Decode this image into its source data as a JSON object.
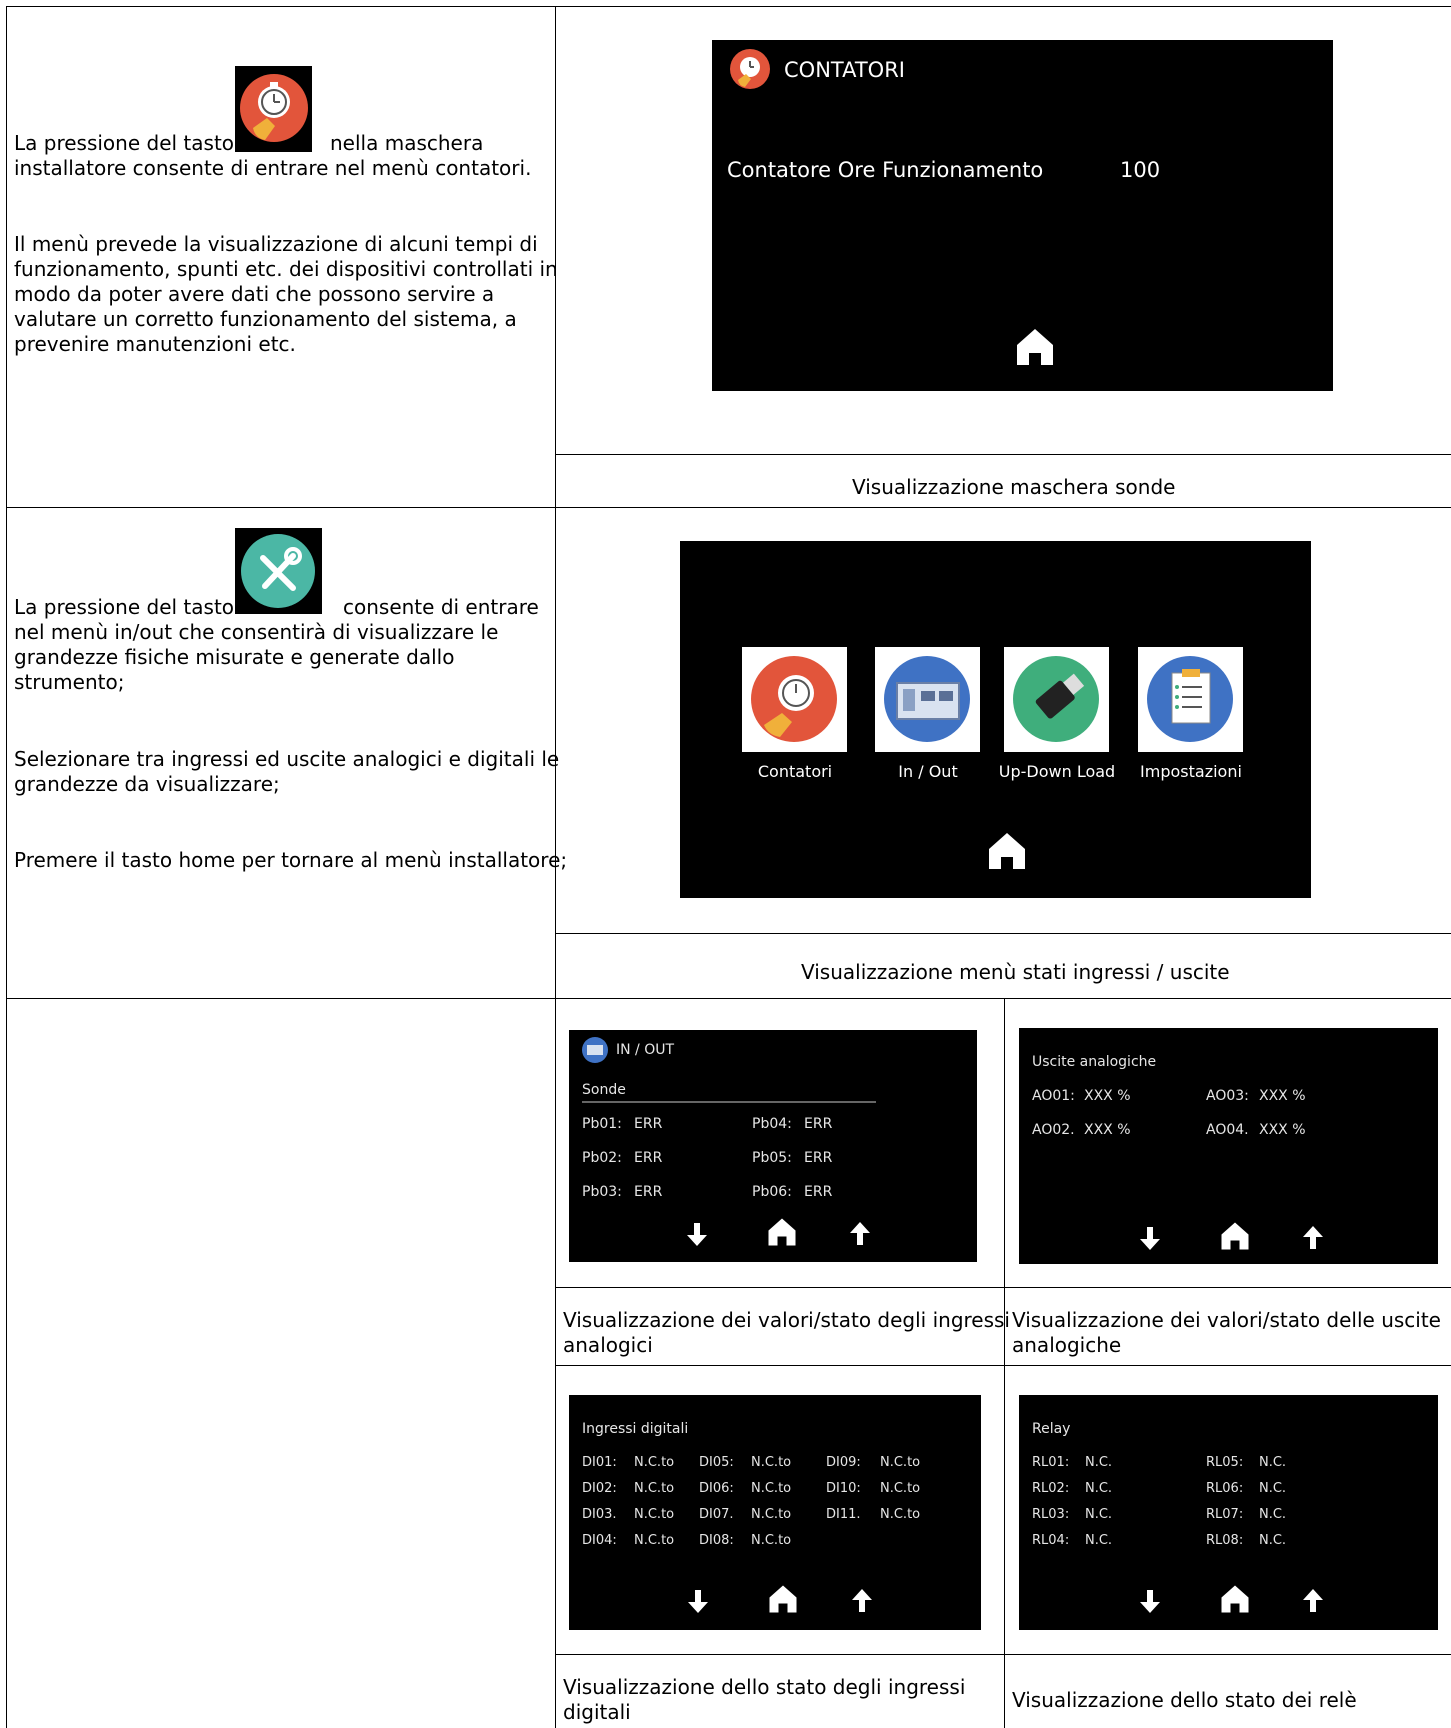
{
  "section1": {
    "text_before_icon": "La pressione del tasto",
    "text_after_icon": "nella maschera",
    "text_line2": "installatore consente di entrare nel menù contatori.",
    "paragraph2": [
      "Il menù prevede la visualizzazione di alcuni tempi di",
      "funzionamento, spunti etc. dei dispositivi controllati in",
      "modo da poter avere dati che possono servire a",
      "valutare un corretto funzionamento del sistema, a",
      "prevenire manutenzioni etc."
    ],
    "screen": {
      "title": "CONTATORI",
      "row_label": "Contatore Ore Funzionamento",
      "row_value": "100"
    },
    "caption": "Visualizzazione maschera sonde"
  },
  "section2": {
    "text_before_icon": "La pressione del tasto",
    "text_after_icon": "consente di entrare",
    "lines": [
      "nel menù in/out che consentirà di visualizzare le",
      "grandezze fisiche misurate e generate dallo",
      "strumento;"
    ],
    "paragraph2": [
      "Selezionare tra ingressi ed uscite analogici e digitali le",
      "grandezze da visualizzare;"
    ],
    "paragraph3": "Premere il tasto home per tornare al menù installatore;",
    "screen": {
      "tiles": [
        {
          "label": "Contatori",
          "icon": "stopwatch-icon"
        },
        {
          "label": "In / Out",
          "icon": "circuit-board-icon"
        },
        {
          "label": "Up-Down Load",
          "icon": "usb-drive-icon"
        },
        {
          "label": "Impostazioni",
          "icon": "clipboard-icon"
        }
      ]
    },
    "caption": "Visualizzazione menù stati ingressi / uscite"
  },
  "section3": {
    "inout_screen": {
      "title": "IN / OUT",
      "subtitle": "Sonde",
      "rows": [
        [
          "Pb01:",
          "ERR",
          "Pb04:",
          "ERR"
        ],
        [
          "Pb02:",
          "ERR",
          "Pb05:",
          "ERR"
        ],
        [
          "Pb03:",
          "ERR",
          "Pb06:",
          "ERR"
        ]
      ]
    },
    "analog_out_screen": {
      "title": "Uscite analogiche",
      "rows": [
        [
          "AO01:",
          "XXX %",
          "AO03:",
          "XXX %"
        ],
        [
          "AO02.",
          "XXX %",
          "AO04.",
          "XXX %"
        ]
      ]
    },
    "digital_in_screen": {
      "title": "Ingressi digitali",
      "rows": [
        [
          "DI01:",
          "N.C.to",
          "DI05:",
          "N.C.to",
          "DI09:",
          "N.C.to"
        ],
        [
          "DI02:",
          "N.C.to",
          "DI06:",
          "N.C.to",
          "DI10:",
          "N.C.to"
        ],
        [
          "DI03.",
          "N.C.to",
          "DI07.",
          "N.C.to",
          "DI11.",
          "N.C.to"
        ],
        [
          "DI04:",
          "N.C.to",
          "DI08:",
          "N.C.to"
        ]
      ]
    },
    "relay_screen": {
      "title": "Relay",
      "rows": [
        [
          "RL01:",
          "N.C.",
          "RL05:",
          "N.C."
        ],
        [
          "RL02:",
          "N.C.",
          "RL06:",
          "N.C."
        ],
        [
          "RL03:",
          "N.C.",
          "RL07:",
          "N.C."
        ],
        [
          "RL04:",
          "N.C.",
          "RL08:",
          "N.C."
        ]
      ]
    },
    "captions": {
      "analog_in": [
        "Visualizzazione dei valori/stato degli ingressi",
        "analogici"
      ],
      "analog_out": [
        "Visualizzazione dei valori/stato delle uscite",
        "analogiche"
      ],
      "digital_in": [
        "Visualizzazione dello stato degli ingressi",
        "digitali"
      ],
      "relay": "Visualizzazione dello stato dei relè"
    }
  }
}
